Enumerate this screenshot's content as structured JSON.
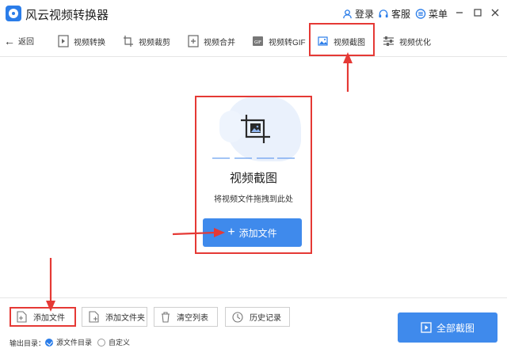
{
  "app": {
    "title": "风云视频转换器"
  },
  "titlebar": {
    "login": "登录",
    "service": "客服",
    "menu": "菜单"
  },
  "toolbar": {
    "back": "返回",
    "tools": [
      {
        "label": "视频转换",
        "icon": "video-convert-icon"
      },
      {
        "label": "视频裁剪",
        "icon": "video-crop-icon"
      },
      {
        "label": "视频合并",
        "icon": "video-merge-icon"
      },
      {
        "label": "视频转GIF",
        "icon": "gif-icon"
      },
      {
        "label": "视频截图",
        "icon": "screenshot-icon",
        "active": true
      },
      {
        "label": "视频优化",
        "icon": "optimize-icon"
      }
    ]
  },
  "dropzone": {
    "title": "视频截图",
    "hint": "将视频文件拖拽到此处",
    "add_button": "添加文件"
  },
  "bottom": {
    "buttons": [
      "添加文件",
      "添加文件夹",
      "清空列表",
      "历史记录"
    ],
    "output_label": "输出目录：",
    "radio_source": "源文件目录",
    "radio_custom": "自定义",
    "convert_all": "全部截图"
  },
  "colors": {
    "accent": "#3f8aec",
    "highlight_red": "#e53935"
  }
}
